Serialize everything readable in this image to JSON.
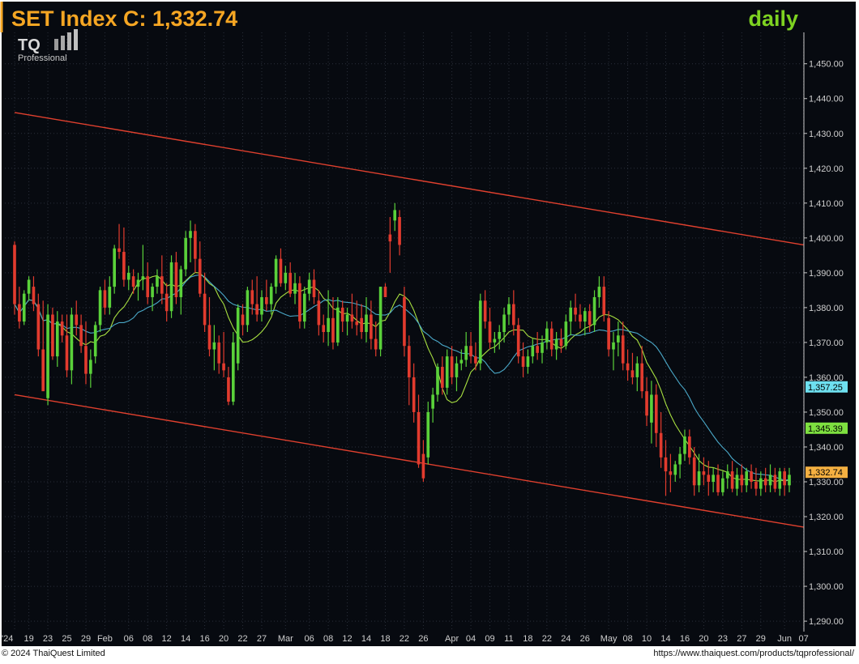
{
  "header": {
    "title": "SET Index C: 1,332.74",
    "period": "daily"
  },
  "logo": {
    "mark": "TQ",
    "sub": "Professional"
  },
  "footer": {
    "copyright": "© 2024 ThaiQuest Limited",
    "url": "https://www.thaiquest.com/products/tqprofessional/"
  },
  "colors": {
    "background": "#070a10",
    "grid": "#2a2f3a",
    "up": "#5ad13a",
    "down": "#e23b2e",
    "channel": "#e0402e",
    "ma_fast": "#a8e040",
    "ma_slow": "#4aa8c8",
    "title": "#f5a623",
    "period": "#7ed321"
  },
  "chart_data": {
    "type": "candlestick",
    "title": "SET Index C: 1,332.74",
    "x_tick_labels": [
      "'24",
      "19",
      "23",
      "25",
      "29",
      "Feb",
      "06",
      "08",
      "12",
      "14",
      "16",
      "20",
      "22",
      "27",
      "Mar",
      "06",
      "08",
      "12",
      "14",
      "18",
      "22",
      "26",
      "Apr",
      "04",
      "09",
      "11",
      "18",
      "22",
      "24",
      "26",
      "May",
      "08",
      "10",
      "14",
      "16",
      "20",
      "23",
      "27",
      "29",
      "Jun",
      "07"
    ],
    "x_tick_index": [
      0,
      3,
      7,
      11,
      15,
      19,
      24,
      28,
      32,
      36,
      40,
      44,
      48,
      52,
      57,
      62,
      66,
      70,
      74,
      78,
      82,
      86,
      92,
      96,
      100,
      104,
      108,
      112,
      116,
      120,
      125,
      129,
      133,
      137,
      141,
      145,
      149,
      153,
      157,
      162,
      166
    ],
    "y_ticks": [
      1290,
      1300,
      1310,
      1320,
      1330,
      1340,
      1350,
      1360,
      1370,
      1380,
      1390,
      1400,
      1410,
      1420,
      1430,
      1440,
      1450
    ],
    "ylim": [
      1287,
      1459
    ],
    "price_tags": [
      {
        "label": "1,357.25",
        "value": 1357.25,
        "color": "#6ee0f0"
      },
      {
        "label": "1,345.39",
        "value": 1345.39,
        "color": "#7ee040"
      },
      {
        "label": "1,332.74",
        "value": 1332.74,
        "color": "#f5b041"
      }
    ],
    "channel_lines": [
      {
        "name": "upper",
        "from": [
          0,
          1436
        ],
        "to": [
          166,
          1398
        ]
      },
      {
        "name": "lower",
        "from": [
          0,
          1355
        ],
        "to": [
          166,
          1317
        ]
      }
    ],
    "candles": [
      [
        1398,
        1399,
        1378,
        1381
      ],
      [
        1381,
        1386,
        1374,
        1376
      ],
      [
        1376,
        1385,
        1375,
        1384
      ],
      [
        1384,
        1389,
        1382,
        1388
      ],
      [
        1386,
        1389,
        1379,
        1381
      ],
      [
        1381,
        1384,
        1366,
        1368
      ],
      [
        1368,
        1382,
        1357,
        1356
      ],
      [
        1354,
        1381,
        1352,
        1378
      ],
      [
        1378,
        1380,
        1365,
        1366
      ],
      [
        1366,
        1379,
        1363,
        1376
      ],
      [
        1376,
        1378,
        1370,
        1372
      ],
      [
        1372,
        1378,
        1360,
        1362
      ],
      [
        1362,
        1380,
        1358,
        1378
      ],
      [
        1378,
        1382,
        1372,
        1375
      ],
      [
        1375,
        1378,
        1367,
        1369
      ],
      [
        1369,
        1376,
        1358,
        1361
      ],
      [
        1361,
        1368,
        1357,
        1365
      ],
      [
        1366,
        1376,
        1364,
        1375
      ],
      [
        1375,
        1386,
        1373,
        1385
      ],
      [
        1385,
        1388,
        1378,
        1380
      ],
      [
        1380,
        1389,
        1378,
        1386
      ],
      [
        1386,
        1398,
        1384,
        1397
      ],
      [
        1397,
        1404,
        1394,
        1396
      ],
      [
        1396,
        1403,
        1386,
        1388
      ],
      [
        1388,
        1392,
        1385,
        1390
      ],
      [
        1389,
        1391,
        1384,
        1386
      ],
      [
        1386,
        1390,
        1382,
        1388
      ],
      [
        1388,
        1398,
        1385,
        1389
      ],
      [
        1389,
        1393,
        1381,
        1383
      ],
      [
        1383,
        1387,
        1379,
        1386
      ],
      [
        1386,
        1391,
        1384,
        1389
      ],
      [
        1389,
        1395,
        1381,
        1384
      ],
      [
        1384,
        1387,
        1376,
        1379
      ],
      [
        1379,
        1395,
        1377,
        1393
      ],
      [
        1393,
        1396,
        1381,
        1383
      ],
      [
        1383,
        1392,
        1378,
        1391
      ],
      [
        1391,
        1402,
        1389,
        1400
      ],
      [
        1400,
        1405,
        1393,
        1402
      ],
      [
        1402,
        1404,
        1390,
        1394
      ],
      [
        1394,
        1399,
        1383,
        1384
      ],
      [
        1384,
        1390,
        1373,
        1375
      ],
      [
        1375,
        1383,
        1366,
        1368
      ],
      [
        1368,
        1375,
        1362,
        1370
      ],
      [
        1370,
        1372,
        1361,
        1364
      ],
      [
        1364,
        1373,
        1360,
        1362
      ],
      [
        1360,
        1363,
        1352,
        1353
      ],
      [
        1353,
        1373,
        1352,
        1370
      ],
      [
        1364,
        1381,
        1362,
        1380
      ],
      [
        1378,
        1381,
        1372,
        1375
      ],
      [
        1375,
        1386,
        1373,
        1385
      ],
      [
        1385,
        1388,
        1378,
        1381
      ],
      [
        1381,
        1389,
        1376,
        1378
      ],
      [
        1378,
        1385,
        1376,
        1383
      ],
      [
        1383,
        1388,
        1379,
        1381
      ],
      [
        1381,
        1387,
        1378,
        1386
      ],
      [
        1386,
        1395,
        1384,
        1394
      ],
      [
        1394,
        1397,
        1386,
        1387
      ],
      [
        1387,
        1392,
        1385,
        1390
      ],
      [
        1390,
        1393,
        1383,
        1384
      ],
      [
        1384,
        1390,
        1381,
        1387
      ],
      [
        1387,
        1389,
        1374,
        1376
      ],
      [
        1376,
        1386,
        1374,
        1384
      ],
      [
        1384,
        1390,
        1382,
        1388
      ],
      [
        1388,
        1391,
        1381,
        1383
      ],
      [
        1382,
        1385,
        1372,
        1375
      ],
      [
        1375,
        1378,
        1370,
        1373
      ],
      [
        1373,
        1385,
        1369,
        1377
      ],
      [
        1377,
        1383,
        1368,
        1370
      ],
      [
        1370,
        1383,
        1369,
        1380
      ],
      [
        1380,
        1382,
        1373,
        1376
      ],
      [
        1376,
        1380,
        1372,
        1378
      ],
      [
        1378,
        1384,
        1374,
        1376
      ],
      [
        1376,
        1382,
        1372,
        1375
      ],
      [
        1377,
        1381,
        1371,
        1373
      ],
      [
        1373,
        1383,
        1370,
        1378
      ],
      [
        1378,
        1382,
        1368,
        1371
      ],
      [
        1371,
        1376,
        1366,
        1368
      ],
      [
        1368,
        1386,
        1366,
        1386
      ],
      [
        1386,
        1387,
        1383,
        1383
      ],
      [
        1401,
        1406,
        1390,
        1399
      ],
      [
        1405,
        1410,
        1402,
        1408
      ],
      [
        1406,
        1408,
        1395,
        1398
      ],
      [
        1383,
        1386,
        1366,
        1369
      ],
      [
        1369,
        1372,
        1352,
        1360
      ],
      [
        1360,
        1364,
        1347,
        1350
      ],
      [
        1350,
        1355,
        1334,
        1335
      ],
      [
        1338,
        1342,
        1330,
        1331
      ],
      [
        1337,
        1353,
        1335,
        1350
      ],
      [
        1351,
        1357,
        1347,
        1355
      ],
      [
        1355,
        1364,
        1353,
        1363
      ],
      [
        1363,
        1366,
        1355,
        1357
      ],
      [
        1357,
        1368,
        1355,
        1366
      ],
      [
        1366,
        1369,
        1358,
        1360
      ],
      [
        1360,
        1366,
        1356,
        1364
      ],
      [
        1364,
        1368,
        1362,
        1365
      ],
      [
        1365,
        1373,
        1363,
        1369
      ],
      [
        1369,
        1373,
        1364,
        1366
      ],
      [
        1366,
        1370,
        1362,
        1364
      ],
      [
        1364,
        1384,
        1362,
        1382
      ],
      [
        1382,
        1385,
        1374,
        1376
      ],
      [
        1376,
        1380,
        1368,
        1370
      ],
      [
        1370,
        1373,
        1367,
        1371
      ],
      [
        1371,
        1375,
        1368,
        1373
      ],
      [
        1373,
        1380,
        1370,
        1378
      ],
      [
        1378,
        1383,
        1375,
        1381
      ],
      [
        1381,
        1385,
        1372,
        1375
      ],
      [
        1375,
        1377,
        1364,
        1366
      ],
      [
        1366,
        1370,
        1360,
        1363
      ],
      [
        1363,
        1368,
        1361,
        1366
      ],
      [
        1366,
        1371,
        1364,
        1369
      ],
      [
        1369,
        1373,
        1365,
        1367
      ],
      [
        1367,
        1372,
        1364,
        1370
      ],
      [
        1370,
        1376,
        1368,
        1374
      ],
      [
        1374,
        1376,
        1366,
        1368
      ],
      [
        1368,
        1373,
        1365,
        1371
      ],
      [
        1371,
        1374,
        1367,
        1369
      ],
      [
        1369,
        1378,
        1368,
        1376
      ],
      [
        1376,
        1382,
        1372,
        1380
      ],
      [
        1380,
        1384,
        1376,
        1378
      ],
      [
        1378,
        1381,
        1374,
        1376
      ],
      [
        1376,
        1380,
        1372,
        1379
      ],
      [
        1379,
        1381,
        1373,
        1375
      ],
      [
        1375,
        1385,
        1373,
        1383
      ],
      [
        1383,
        1389,
        1380,
        1386
      ],
      [
        1386,
        1389,
        1376,
        1378
      ],
      [
        1377,
        1379,
        1366,
        1368
      ],
      [
        1368,
        1373,
        1362,
        1370
      ],
      [
        1370,
        1376,
        1366,
        1372
      ],
      [
        1372,
        1376,
        1362,
        1364
      ],
      [
        1364,
        1368,
        1359,
        1362
      ],
      [
        1362,
        1367,
        1358,
        1360
      ],
      [
        1360,
        1366,
        1356,
        1364
      ],
      [
        1364,
        1369,
        1354,
        1356
      ],
      [
        1356,
        1360,
        1346,
        1349
      ],
      [
        1347,
        1359,
        1341,
        1355
      ],
      [
        1355,
        1358,
        1340,
        1344
      ],
      [
        1344,
        1350,
        1334,
        1337
      ],
      [
        1337,
        1342,
        1326,
        1333
      ],
      [
        1333,
        1338,
        1327,
        1332
      ],
      [
        1332,
        1336,
        1330,
        1335
      ],
      [
        1335,
        1340,
        1331,
        1338
      ],
      [
        1338,
        1345,
        1336,
        1343
      ],
      [
        1343,
        1345,
        1335,
        1337
      ],
      [
        1337,
        1340,
        1326,
        1329
      ],
      [
        1329,
        1338,
        1327,
        1333
      ],
      [
        1333,
        1337,
        1329,
        1332
      ],
      [
        1332,
        1336,
        1326,
        1330
      ],
      [
        1330,
        1334,
        1327,
        1332
      ],
      [
        1332,
        1335,
        1326,
        1327
      ],
      [
        1327,
        1333,
        1326,
        1331
      ],
      [
        1331,
        1335,
        1328,
        1333
      ],
      [
        1333,
        1336,
        1327,
        1328
      ],
      [
        1328,
        1334,
        1326,
        1332
      ],
      [
        1332,
        1335,
        1327,
        1329
      ],
      [
        1329,
        1334,
        1327,
        1333
      ],
      [
        1333,
        1335,
        1328,
        1330
      ],
      [
        1330,
        1334,
        1326,
        1328
      ],
      [
        1328,
        1333,
        1326,
        1331
      ],
      [
        1331,
        1334,
        1327,
        1329
      ],
      [
        1329,
        1335,
        1327,
        1332
      ],
      [
        1332,
        1334,
        1327,
        1328
      ],
      [
        1328,
        1334,
        1326,
        1333
      ],
      [
        1333,
        1334,
        1326,
        1329
      ],
      [
        1329,
        1334,
        1327,
        1332
      ]
    ]
  }
}
